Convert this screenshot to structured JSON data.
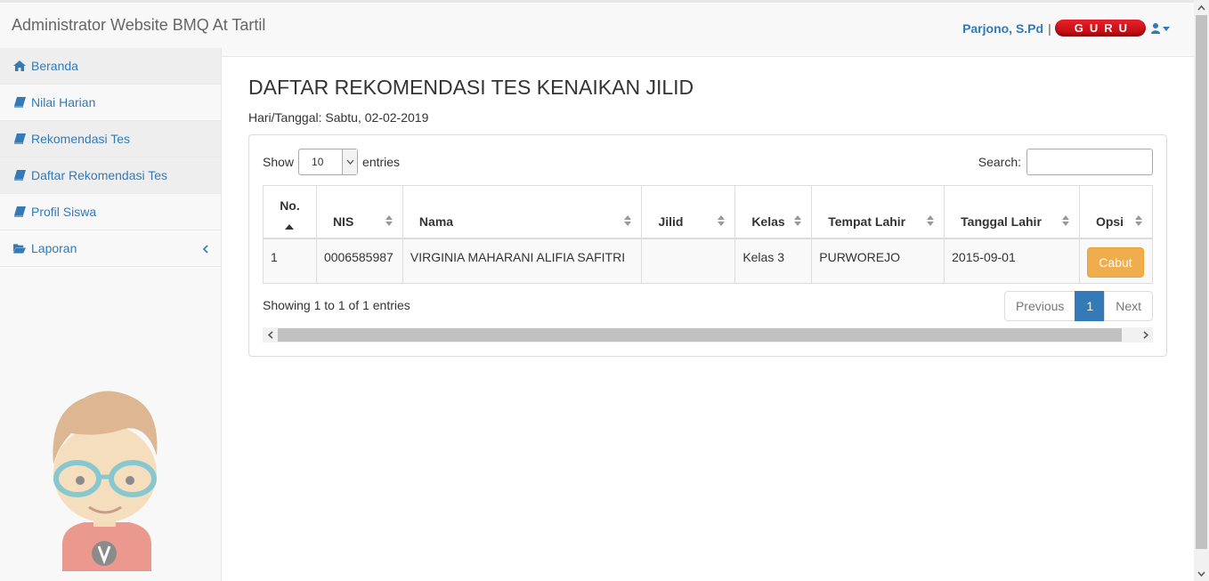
{
  "app": {
    "title": "Administrator Website BMQ At Tartil"
  },
  "user": {
    "name": "Parjono, S.Pd",
    "separator": "|",
    "role": "GURU",
    "menu_icon": "user-icon"
  },
  "sidebar": {
    "items": [
      {
        "label": "Beranda",
        "icon": "home-icon"
      },
      {
        "label": "Nilai Harian",
        "icon": "book-icon"
      },
      {
        "label": "Rekomendasi Tes",
        "icon": "book-icon"
      },
      {
        "label": "Daftar Rekomendasi Tes",
        "icon": "book-icon"
      },
      {
        "label": "Profil Siswa",
        "icon": "book-icon"
      },
      {
        "label": "Laporan",
        "icon": "folder-open-icon"
      }
    ]
  },
  "main": {
    "title": "DAFTAR REKOMENDASI TES KENAIKAN JILID",
    "date_line": "Hari/Tanggal: Sabtu, 02-02-2019"
  },
  "table": {
    "show_label": "Show",
    "entries_label": "entries",
    "page_size": "10",
    "search_label": "Search:",
    "search_value": "",
    "columns": [
      "No.",
      "NIS",
      "Nama",
      "Jilid",
      "Kelas",
      "Tempat Lahir",
      "Tanggal Lahir",
      "Opsi"
    ],
    "rows": [
      {
        "no": "1",
        "nis": "0006585987",
        "nama": "VIRGINIA MAHARANI ALIFIA SAFITRI",
        "jilid": "",
        "kelas": "Kelas 3",
        "tempat_lahir": "PURWOREJO",
        "tanggal_lahir": "2015-09-01",
        "action": "Cabut"
      }
    ],
    "info": "Showing 1 to 1 of 1 entries",
    "pagination": {
      "previous": "Previous",
      "current": "1",
      "next": "Next"
    }
  },
  "colors": {
    "link": "#337ab7",
    "badge": "#d7141c",
    "action_button": "#f0ad4e",
    "active_page": "#337ab7"
  }
}
